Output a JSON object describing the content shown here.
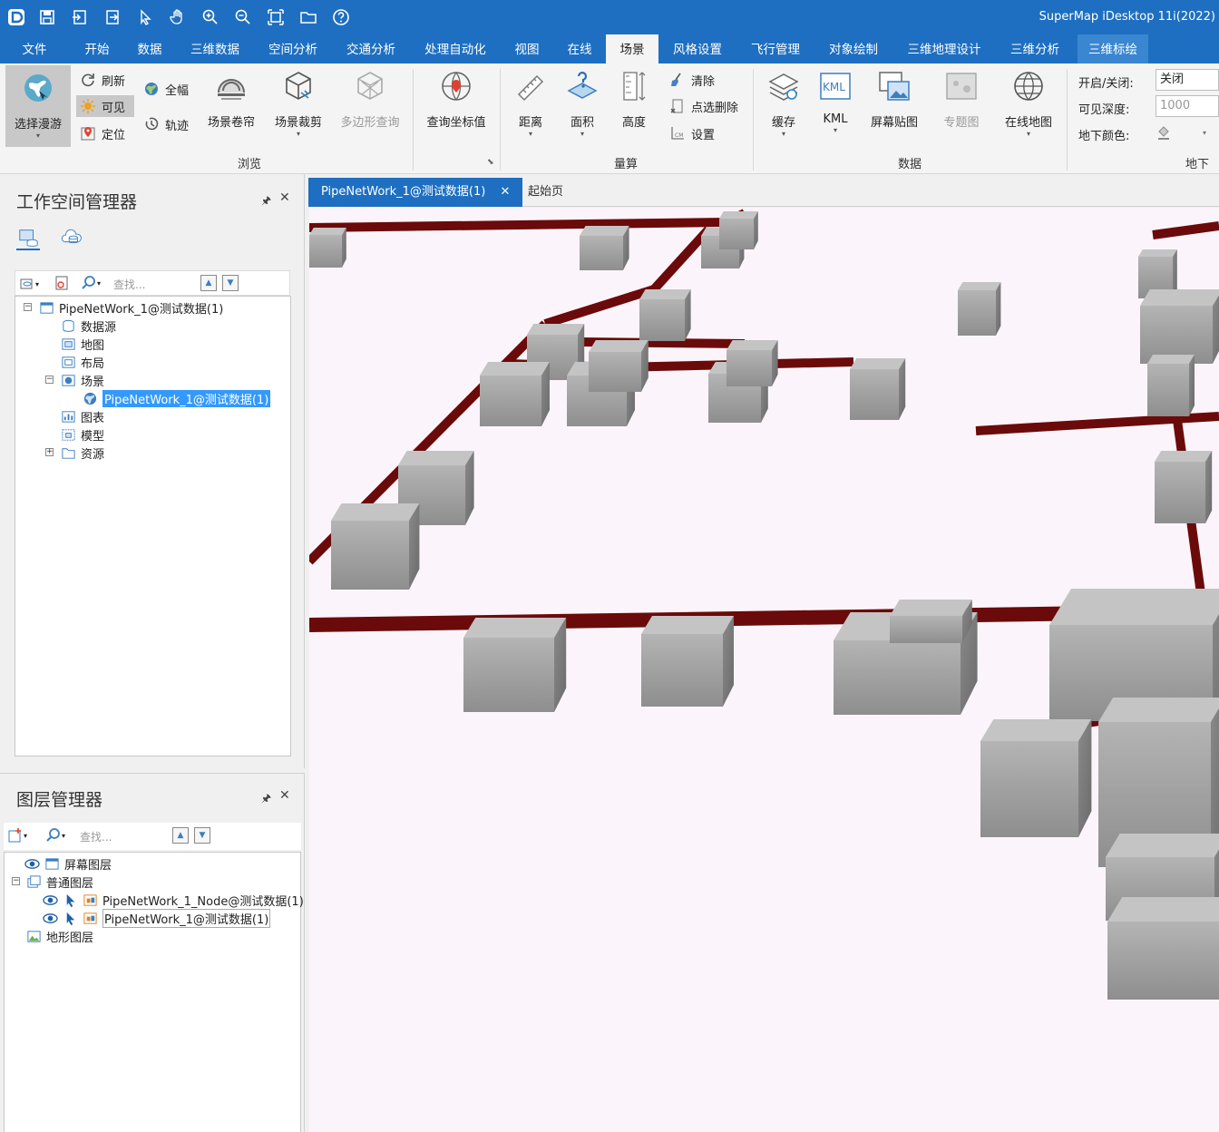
{
  "window": {
    "title": "SuperMap iDesktop 11i(2022)"
  },
  "quick_access": [
    "app-logo-icon",
    "save-icon",
    "import-icon",
    "export-icon",
    "select-arrow-icon",
    "pan-hand-icon",
    "zoom-in-icon",
    "zoom-out-icon",
    "full-extent-icon",
    "open-folder-icon",
    "help-icon"
  ],
  "ribbon_tabs": [
    "文件",
    "开始",
    "数据",
    "三维数据",
    "空间分析",
    "交通分析",
    "处理自动化",
    "视图",
    "在线",
    "场景",
    "风格设置",
    "飞行管理",
    "对象绘制",
    "三维地理设计",
    "三维分析",
    "三维标绘"
  ],
  "active_tab": "场景",
  "ribbon": {
    "browse": {
      "group_label": "浏览",
      "select_roam": "选择漫游",
      "refresh": "刷新",
      "visible": "可见",
      "locate": "定位",
      "full_extent": "全幅",
      "track": "轨迹",
      "scene_shutter": "场景卷帘",
      "scene_clip": "场景裁剪",
      "polygon_query": "多边形查询",
      "query_coord": "查询坐标值"
    },
    "measure": {
      "group_label": "量算",
      "distance": "距离",
      "area": "面积",
      "height": "高度",
      "clear": "清除",
      "point_delete": "点选删除",
      "settings": "设置"
    },
    "data": {
      "group_label": "数据",
      "cache": "缓存",
      "kml": "KML",
      "screen_paste": "屏幕贴图",
      "thematic": "专题图",
      "online_map": "在线地图",
      "kml_icon_text": "KML"
    },
    "underground": {
      "group_label": "地下",
      "toggle_label": "开启/关闭:",
      "toggle_value": "关闭",
      "depth_label": "可见深度:",
      "depth_value": "1000",
      "color_label": "地下颜色:"
    }
  },
  "workspace_panel": {
    "title": "工作空间管理器",
    "search_placeholder": "查找...",
    "tree": {
      "root": "PipeNetWork_1@测试数据(1)",
      "datasource": "数据源",
      "map": "地图",
      "layout": "布局",
      "scene": "场景",
      "scene_item": "PipeNetWork_1@测试数据(1)",
      "chart": "图表",
      "model": "模型",
      "resource": "资源"
    }
  },
  "layer_panel": {
    "title": "图层管理器",
    "search_placeholder": "查找...",
    "layers": {
      "screen": "屏幕图层",
      "normal": "普通图层",
      "node_layer": "PipeNetWork_1_Node@测试数据(1)",
      "net_layer": "PipeNetWork_1@测试数据(1)",
      "terrain": "地形图层"
    }
  },
  "doc_tabs": {
    "active": "PipeNetWork_1@测试数据(1)",
    "close": "✕",
    "start": "起始页"
  },
  "colors": {
    "accent": "#1e6fc1",
    "pipe": "#6b0a0a",
    "scene_bg": "#fbf5fb",
    "selection": "#3399ff"
  }
}
